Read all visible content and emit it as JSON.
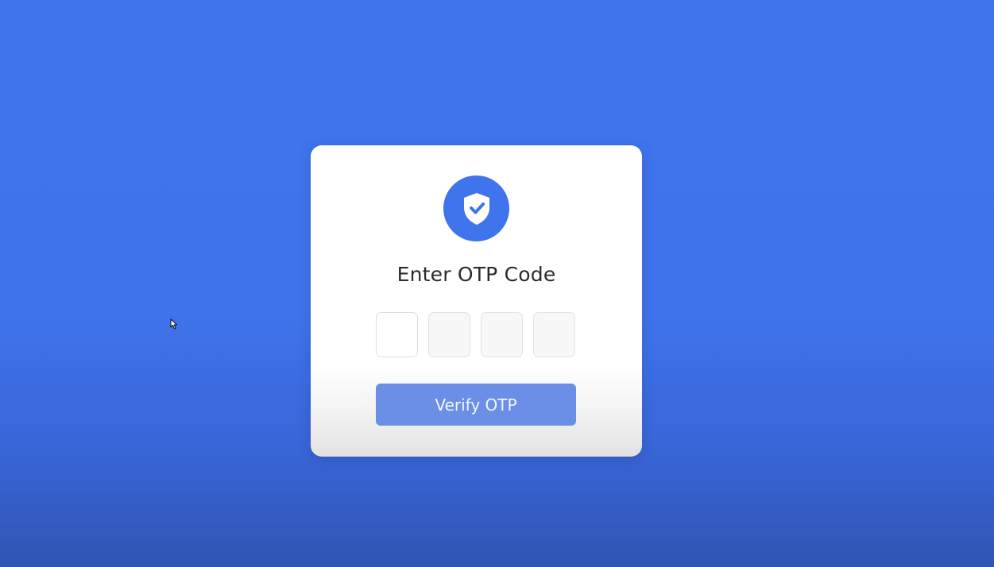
{
  "colors": {
    "background": "#3f74ec",
    "card": "#ffffff",
    "accent": "#3f74ec",
    "button": "#6b8fe6",
    "title_text": "#2b2b2b"
  },
  "header": {
    "icon": "shield-check-icon",
    "title": "Enter OTP Code"
  },
  "otp": {
    "digits": [
      {
        "value": "",
        "state": "enabled"
      },
      {
        "value": "",
        "state": "disabled"
      },
      {
        "value": "",
        "state": "disabled"
      },
      {
        "value": "",
        "state": "disabled"
      }
    ]
  },
  "actions": {
    "verify_label": "Verify OTP",
    "verify_state": "disabled"
  }
}
